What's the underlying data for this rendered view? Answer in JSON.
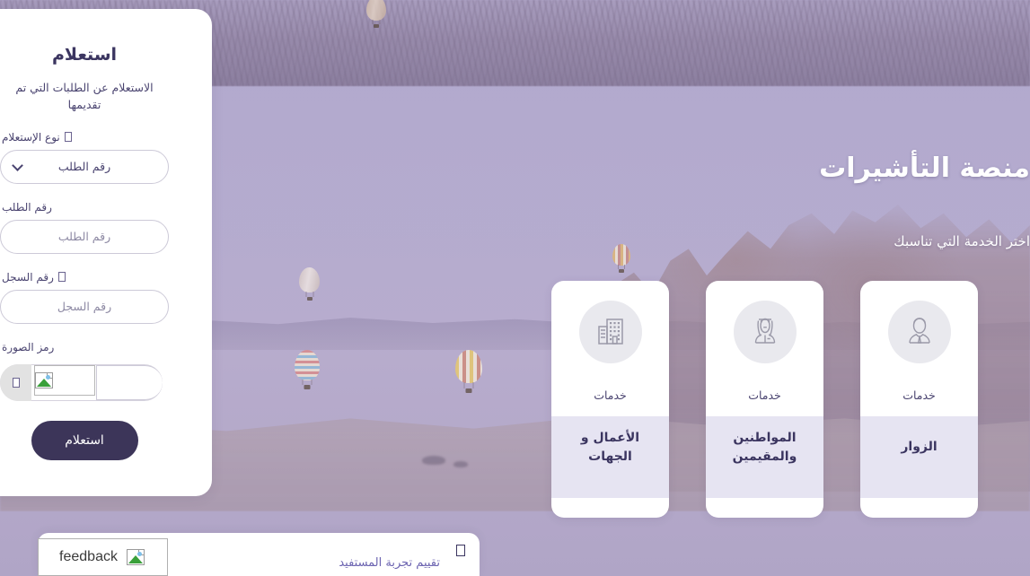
{
  "hero": {
    "title": "منصة التأشيرات",
    "subtitle": "اختر الخدمة التي تناسبك"
  },
  "form": {
    "title": "استعلام",
    "description": "الاستعلام عن الطلبات التي تم تقديمها",
    "fields": {
      "inquiry_type": {
        "label": "نوع الإستعلام",
        "value": "رقم الطلب",
        "has_info_icon": true
      },
      "request_number": {
        "label": "رقم الطلب",
        "placeholder": "رقم الطلب",
        "value": "",
        "has_info_icon": false
      },
      "record_number": {
        "label": "رقم السجل",
        "placeholder": "رقم السجل",
        "value": "",
        "has_info_icon": true
      },
      "captcha": {
        "label": "رمز الصورة",
        "placeholder": "",
        "value": "",
        "refresh_icon": "refresh-icon",
        "image_icon": "broken-image-icon"
      }
    },
    "submit_label": "استعلام"
  },
  "cards": [
    {
      "icon": "building-icon",
      "kicker": "خدمات",
      "title": "الأعمال و الجهات"
    },
    {
      "icon": "saudi-citizen-icon",
      "kicker": "خدمات",
      "title": "المواطنين والمقيمين"
    },
    {
      "icon": "business-person-icon",
      "kicker": "خدمات",
      "title": "الزوار"
    }
  ],
  "bottom_bar": {
    "text": "تقييم تجربة المستفيد",
    "icon": "square-icon"
  },
  "feedback_widget": {
    "label": "feedback",
    "icon": "broken-image-icon"
  },
  "colors": {
    "brand_dark": "#3c3559",
    "band_lavender": "#e6e4f2",
    "text_purple": "#4a4470",
    "link_purple": "#6b63b0",
    "panel_white": "#ffffff"
  }
}
